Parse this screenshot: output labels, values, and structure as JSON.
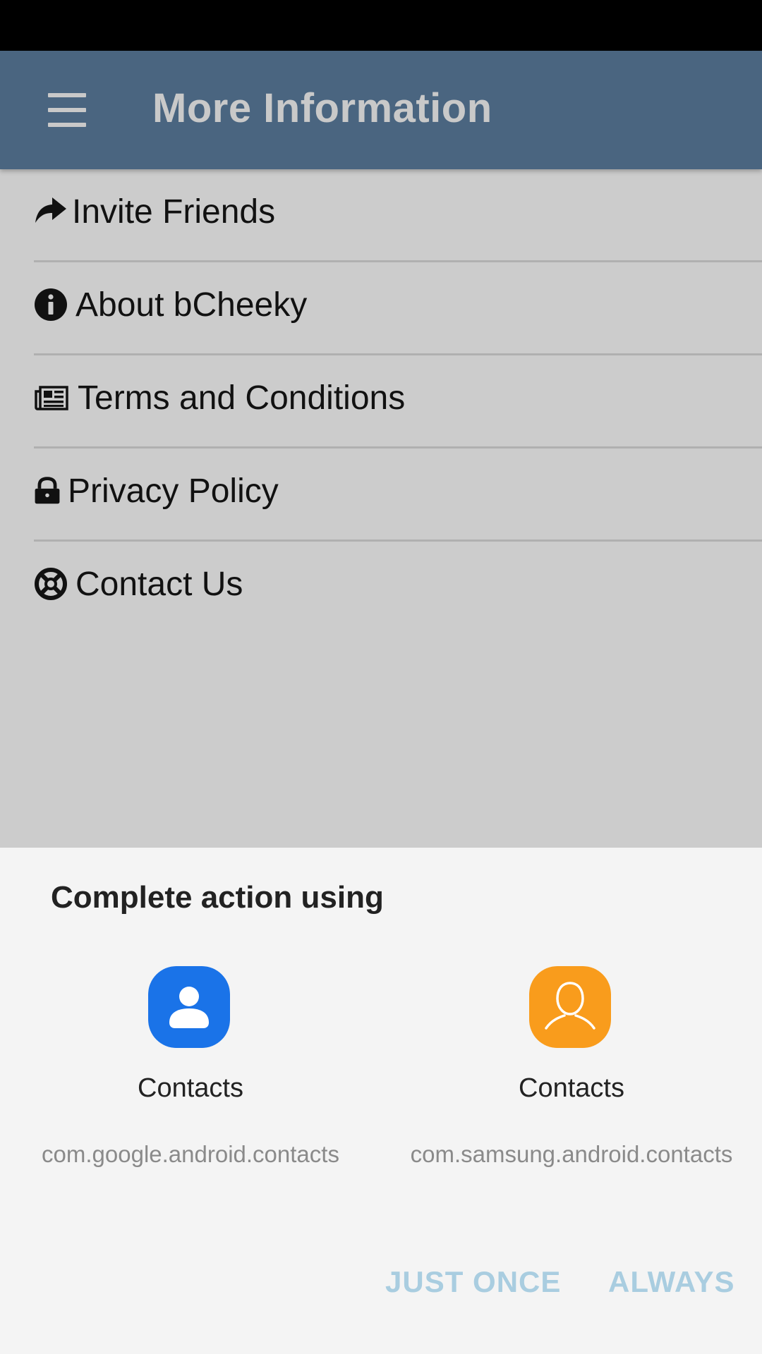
{
  "app_bar": {
    "title": "More Information",
    "menu_icon": "hamburger-menu-icon",
    "color": "#4a6580"
  },
  "menu": {
    "items": [
      {
        "label": "Invite Friends",
        "icon": "share-arrow-icon"
      },
      {
        "label": "About bCheeky",
        "icon": "info-circle-icon"
      },
      {
        "label": "Terms and Conditions",
        "icon": "newspaper-icon"
      },
      {
        "label": "Privacy Policy",
        "icon": "lock-icon"
      },
      {
        "label": "Contact Us",
        "icon": "life-ring-icon"
      }
    ]
  },
  "dialog": {
    "title": "Complete action using",
    "apps": [
      {
        "name": "Contacts",
        "package": "com.google.android.contacts",
        "icon": "google-contacts-icon",
        "color": "#1a73e8"
      },
      {
        "name": "Contacts",
        "package": "com.samsung.android.contacts",
        "icon": "samsung-contacts-icon",
        "color": "#f99c1c"
      }
    ],
    "buttons": {
      "just_once": "JUST ONCE",
      "always": "ALWAYS"
    }
  }
}
